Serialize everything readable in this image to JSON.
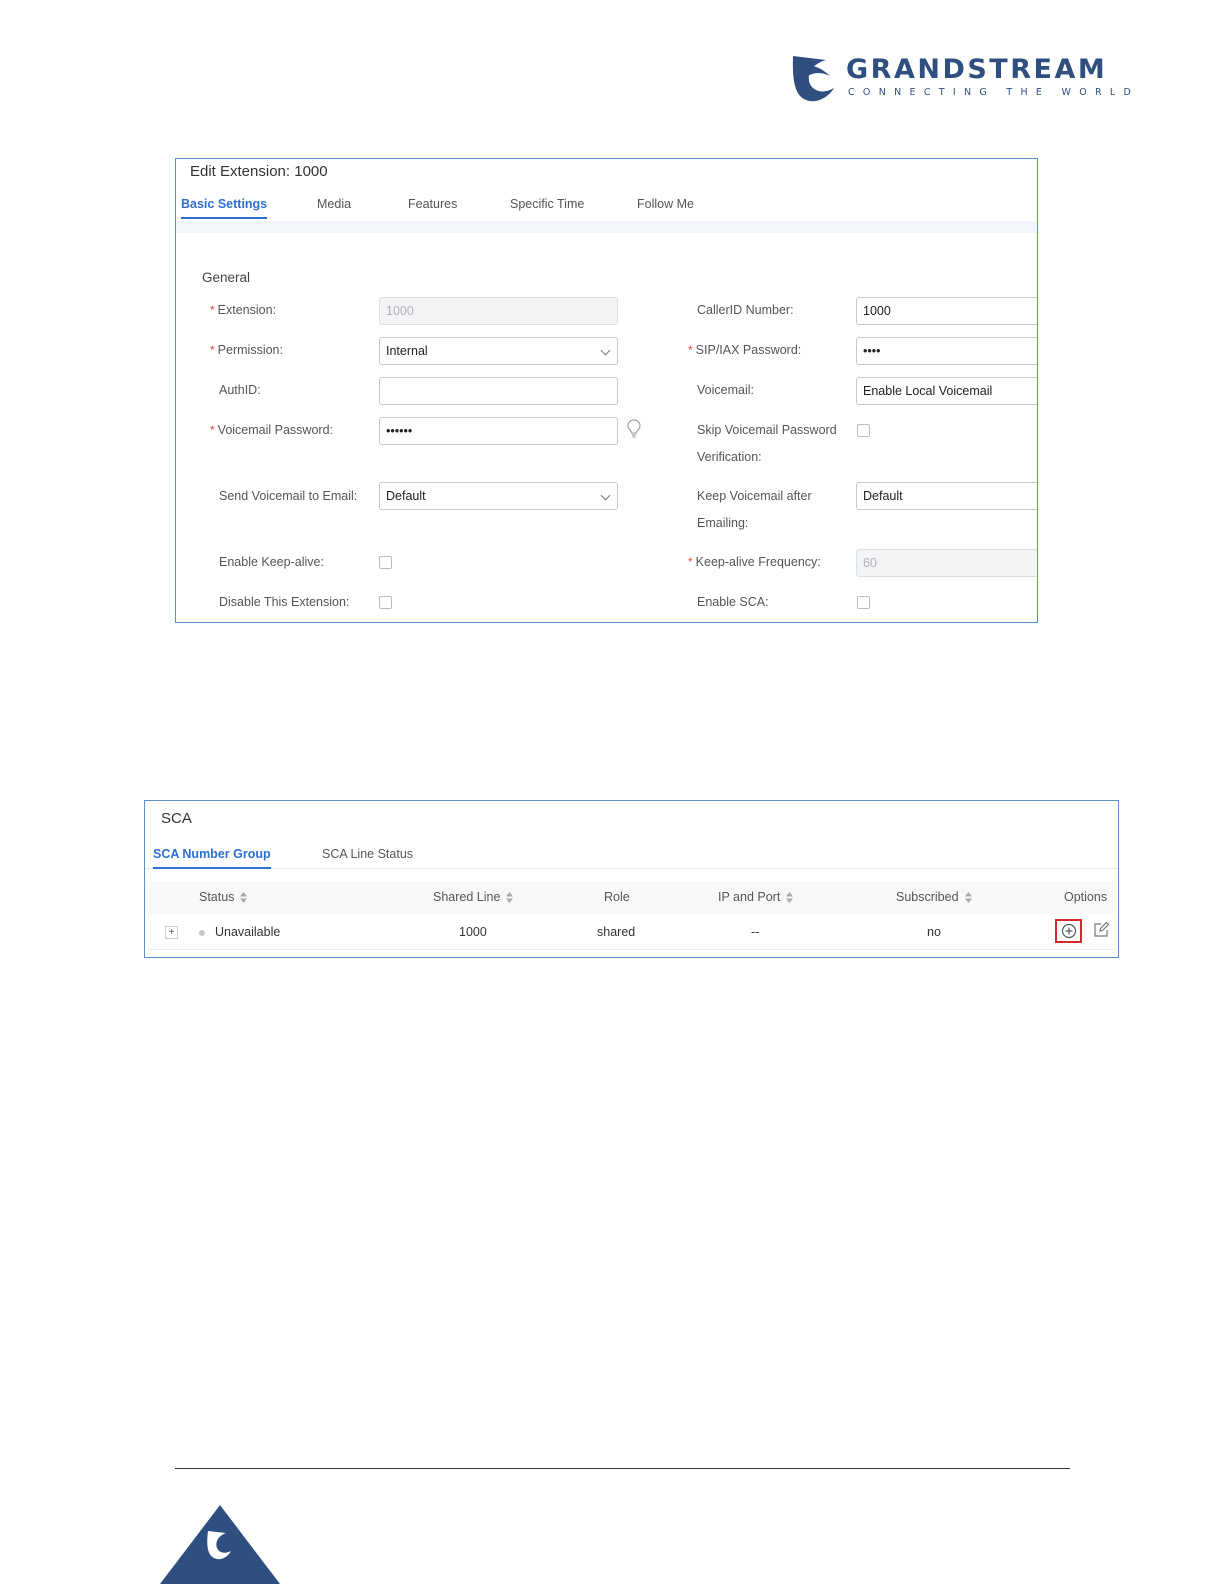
{
  "logo": {
    "brand": "GRANDSTREAM",
    "tagline": "CONNECTING THE WORLD"
  },
  "edit_extension": {
    "title": "Edit Extension: 1000",
    "tabs": [
      "Basic Settings",
      "Media",
      "Features",
      "Specific Time",
      "Follow Me"
    ],
    "active_tab": "Basic Settings",
    "section_title": "General",
    "fields": {
      "extension": {
        "label": "Extension:",
        "value": "1000",
        "required": true
      },
      "callerid_number": {
        "label": "CallerID Number:",
        "value": "1000"
      },
      "permission": {
        "label": "Permission:",
        "value": "Internal",
        "required": true
      },
      "sip_iax_password": {
        "label": "SIP/IAX Password:",
        "value": "••••",
        "required": true
      },
      "authid": {
        "label": "AuthID:",
        "value": ""
      },
      "voicemail": {
        "label": "Voicemail:",
        "value": "Enable Local Voicemail"
      },
      "voicemail_password": {
        "label": "Voicemail Password:",
        "value": "••••••",
        "required": true
      },
      "skip_voicemail_password": {
        "label_line1": "Skip Voicemail Password",
        "label_line2": "Verification:",
        "checked": false
      },
      "send_voicemail_to_email": {
        "label": "Send Voicemail to Email:",
        "value": "Default"
      },
      "keep_voicemail_after_emailing": {
        "label_line1": "Keep Voicemail after",
        "label_line2": "Emailing:",
        "value": "Default"
      },
      "enable_keep_alive": {
        "label": "Enable Keep-alive:",
        "checked": false
      },
      "keep_alive_frequency": {
        "label": "Keep-alive Frequency:",
        "value": "60",
        "required": true
      },
      "disable_this_extension": {
        "label": "Disable This Extension:",
        "checked": false
      },
      "enable_sca": {
        "label": "Enable SCA:",
        "checked": false
      }
    },
    "required_mark": "*"
  },
  "sca": {
    "title": "SCA",
    "tabs": [
      "SCA Number Group",
      "SCA Line Status"
    ],
    "active_tab": "SCA Number Group",
    "columns": [
      "Status",
      "Shared Line",
      "Role",
      "IP and Port",
      "Subscribed",
      "Options"
    ],
    "rows": [
      {
        "expand": "+",
        "status": "Unavailable",
        "shared_line": "1000",
        "role": "shared",
        "ip_and_port": "--",
        "subscribed": "no"
      }
    ]
  }
}
